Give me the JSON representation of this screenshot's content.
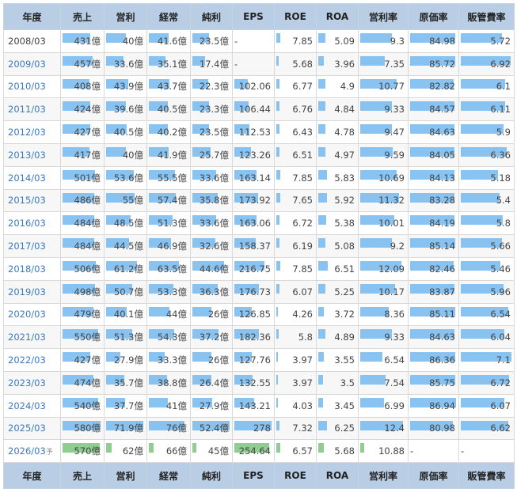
{
  "headers": [
    "年度",
    "売上",
    "営利",
    "経常",
    "純利",
    "EPS",
    "ROE",
    "ROA",
    "営利率",
    "原価率",
    "販管費率"
  ],
  "rows": [
    {
      "year": "2008/03",
      "link": false,
      "forecast": false,
      "cells": [
        "431億",
        "40億",
        "41.6億",
        "23.5億",
        "-",
        "7.85",
        "5.09",
        "9.3",
        "84.98",
        "5.72"
      ],
      "levels": [
        0.72,
        0.53,
        0.5,
        0.45,
        0,
        0.1,
        0.2,
        0.7,
        0.98,
        0.81
      ]
    },
    {
      "year": "2009/03",
      "link": true,
      "forecast": false,
      "cells": [
        "457億",
        "33.6億",
        "35.1億",
        "17.4億",
        "-",
        "5.68",
        "3.96",
        "7.35",
        "85.72",
        "6.92"
      ],
      "levels": [
        0.77,
        0.45,
        0.42,
        0.33,
        0,
        0.07,
        0.15,
        0.55,
        0.99,
        0.98
      ]
    },
    {
      "year": "2010/03",
      "link": true,
      "forecast": false,
      "cells": [
        "408億",
        "43.9億",
        "43.7億",
        "22.3億",
        "102.06",
        "6.77",
        "4.9",
        "10.77",
        "82.82",
        "6.1"
      ],
      "levels": [
        0.69,
        0.59,
        0.53,
        0.43,
        0.37,
        0.09,
        0.19,
        0.81,
        0.95,
        0.87
      ]
    },
    {
      "year": "2011/03",
      "link": true,
      "forecast": false,
      "cells": [
        "424億",
        "39.6億",
        "40.5億",
        "23.3億",
        "106.44",
        "6.76",
        "4.84",
        "9.33",
        "84.57",
        "6.11"
      ],
      "levels": [
        0.71,
        0.53,
        0.49,
        0.45,
        0.39,
        0.09,
        0.19,
        0.7,
        0.97,
        0.87
      ]
    },
    {
      "year": "2012/03",
      "link": true,
      "forecast": false,
      "cells": [
        "427億",
        "40.5億",
        "40.2億",
        "23.5億",
        "112.53",
        "6.43",
        "4.78",
        "9.47",
        "84.63",
        "5.9"
      ],
      "levels": [
        0.72,
        0.54,
        0.48,
        0.45,
        0.41,
        0.08,
        0.19,
        0.71,
        0.97,
        0.84
      ]
    },
    {
      "year": "2013/03",
      "link": true,
      "forecast": false,
      "cells": [
        "417億",
        "40億",
        "41.9億",
        "25.7億",
        "123.26",
        "6.51",
        "4.97",
        "9.59",
        "84.05",
        "6.36"
      ],
      "levels": [
        0.7,
        0.53,
        0.5,
        0.49,
        0.45,
        0.08,
        0.19,
        0.72,
        0.97,
        0.9
      ]
    },
    {
      "year": "2014/03",
      "link": true,
      "forecast": false,
      "cells": [
        "501億",
        "53.6億",
        "55.5億",
        "33.6億",
        "163.14",
        "7.85",
        "5.83",
        "10.69",
        "84.13",
        "5.18"
      ],
      "levels": [
        0.84,
        0.72,
        0.67,
        0.64,
        0.6,
        0.1,
        0.23,
        0.81,
        0.97,
        0.74
      ]
    },
    {
      "year": "2015/03",
      "link": true,
      "forecast": false,
      "cells": [
        "486億",
        "55億",
        "57.4億",
        "35.8億",
        "173.92",
        "7.65",
        "5.92",
        "11.32",
        "83.28",
        "5.4"
      ],
      "levels": [
        0.82,
        0.74,
        0.69,
        0.68,
        0.64,
        0.1,
        0.23,
        0.86,
        0.96,
        0.77
      ]
    },
    {
      "year": "2016/03",
      "link": true,
      "forecast": false,
      "cells": [
        "484億",
        "48.5億",
        "51.3億",
        "33.6億",
        "163.06",
        "6.72",
        "5.38",
        "10.01",
        "84.19",
        "5.8"
      ],
      "levels": [
        0.81,
        0.65,
        0.62,
        0.64,
        0.6,
        0.09,
        0.21,
        0.76,
        0.97,
        0.83
      ]
    },
    {
      "year": "2017/03",
      "link": true,
      "forecast": false,
      "cells": [
        "484億",
        "44.5億",
        "46.9億",
        "32.6億",
        "158.37",
        "6.19",
        "5.08",
        "9.2",
        "85.14",
        "5.66"
      ],
      "levels": [
        0.81,
        0.6,
        0.57,
        0.62,
        0.58,
        0.08,
        0.2,
        0.7,
        0.98,
        0.81
      ]
    },
    {
      "year": "2018/03",
      "link": true,
      "forecast": false,
      "cells": [
        "506億",
        "61.2億",
        "63.5億",
        "44.6億",
        "216.75",
        "7.85",
        "6.51",
        "12.09",
        "82.46",
        "5.46"
      ],
      "levels": [
        0.85,
        0.82,
        0.77,
        0.85,
        0.8,
        0.1,
        0.25,
        0.91,
        0.95,
        0.78
      ]
    },
    {
      "year": "2019/03",
      "link": true,
      "forecast": false,
      "cells": [
        "498億",
        "50.7億",
        "53.3億",
        "36.3億",
        "176.73",
        "6.07",
        "5.25",
        "10.17",
        "83.87",
        "5.96"
      ],
      "levels": [
        0.84,
        0.68,
        0.64,
        0.69,
        0.65,
        0.08,
        0.2,
        0.77,
        0.96,
        0.85
      ]
    },
    {
      "year": "2020/03",
      "link": true,
      "forecast": false,
      "cells": [
        "479億",
        "40.1億",
        "44億",
        "26億",
        "126.85",
        "4.26",
        "3.72",
        "8.36",
        "85.11",
        "6.54"
      ],
      "levels": [
        0.8,
        0.54,
        0.53,
        0.5,
        0.47,
        0.05,
        0.14,
        0.63,
        0.98,
        0.93
      ]
    },
    {
      "year": "2021/03",
      "link": true,
      "forecast": false,
      "cells": [
        "550億",
        "51.3億",
        "54.3億",
        "37.2億",
        "182.36",
        "5.8",
        "4.89",
        "9.33",
        "84.63",
        "6.04"
      ],
      "levels": [
        0.92,
        0.69,
        0.66,
        0.71,
        0.67,
        0.07,
        0.19,
        0.7,
        0.97,
        0.86
      ]
    },
    {
      "year": "2022/03",
      "link": true,
      "forecast": false,
      "cells": [
        "427億",
        "27.9億",
        "33.3億",
        "26億",
        "127.76",
        "3.97",
        "3.55",
        "6.54",
        "86.36",
        "7.1"
      ],
      "levels": [
        0.72,
        0.37,
        0.4,
        0.5,
        0.47,
        0.05,
        0.14,
        0.49,
        0.99,
        1.0
      ]
    },
    {
      "year": "2023/03",
      "link": true,
      "forecast": false,
      "cells": [
        "474億",
        "35.7億",
        "38.8億",
        "26.4億",
        "132.55",
        "3.97",
        "3.5",
        "7.54",
        "85.75",
        "6.72"
      ],
      "levels": [
        0.8,
        0.48,
        0.47,
        0.5,
        0.49,
        0.05,
        0.13,
        0.57,
        0.99,
        0.95
      ]
    },
    {
      "year": "2024/03",
      "link": true,
      "forecast": false,
      "cells": [
        "540億",
        "37.7億",
        "41億",
        "27.9億",
        "143.21",
        "4.03",
        "3.45",
        "6.99",
        "86.94",
        "6.07"
      ],
      "levels": [
        0.91,
        0.51,
        0.49,
        0.53,
        0.53,
        0.05,
        0.13,
        0.53,
        1.0,
        0.86
      ]
    },
    {
      "year": "2025/03",
      "link": true,
      "forecast": false,
      "cells": [
        "580億",
        "71.9億",
        "76億",
        "52.4億",
        "278",
        "7.32",
        "6.25",
        "12.4",
        "80.98",
        "6.62"
      ],
      "levels": [
        0.97,
        0.97,
        0.92,
        1.0,
        1.0,
        0.09,
        0.24,
        0.94,
        0.93,
        0.94
      ]
    },
    {
      "year": "2026/03",
      "suffix": "予",
      "link": true,
      "forecast": true,
      "cells": [
        "570億",
        "62億",
        "66億",
        "45億",
        "254.64",
        "6.57",
        "5.68",
        "10.88",
        "-",
        "-"
      ],
      "levels": [
        0.95,
        0.15,
        0.12,
        0.1,
        0.94,
        0.1,
        0.15,
        0.08,
        0,
        0
      ]
    }
  ]
}
